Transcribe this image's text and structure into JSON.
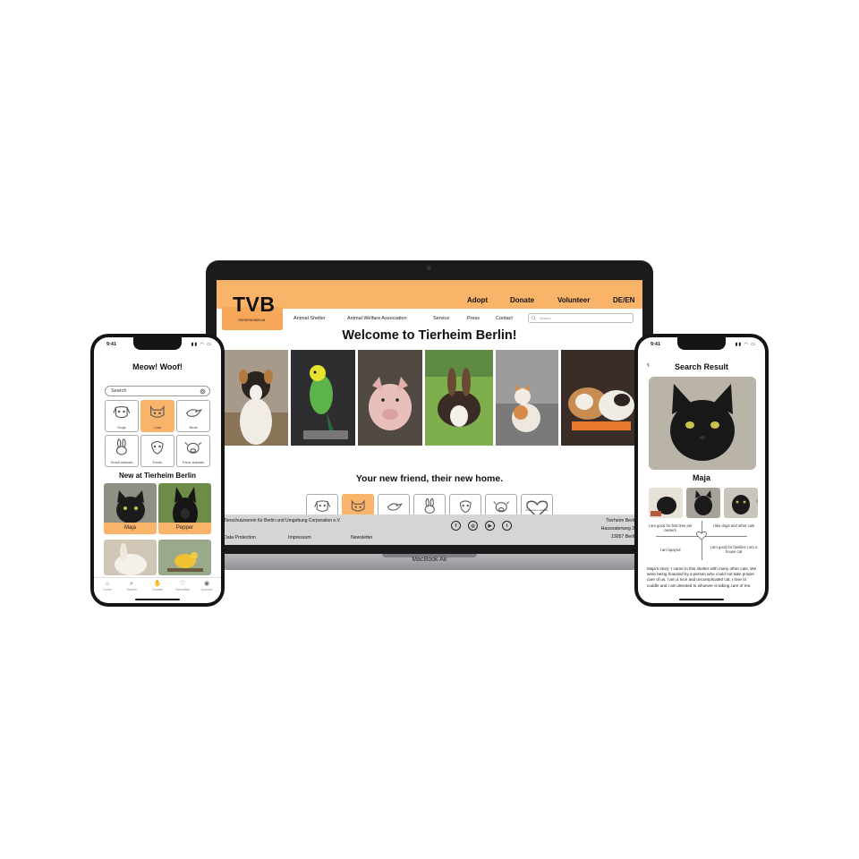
{
  "colors": {
    "accent": "#f9b469",
    "footer": "#d5d5d5",
    "device": "#151515"
  },
  "laptop": {
    "base_label": "MacBook Air",
    "web": {
      "logo": "TVB",
      "logo_tagline": "TIERHEIM BERLIN",
      "top_nav": [
        "Adopt",
        "Donate",
        "Volunteer",
        "DE/EN"
      ],
      "sub_nav": [
        "Animal Shelter",
        "Animal Welfare Association",
        "Service",
        "Press",
        "Contact"
      ],
      "search_placeholder": "Search",
      "title": "Welcome to Tierheim Berlin!",
      "photos": [
        "dog-photo",
        "budgie-photo",
        "pig-photo",
        "rabbit-photo",
        "cat-photo",
        "guinea-pig-photo"
      ],
      "subtitle": "Your new friend, their new home.",
      "categories": [
        {
          "label": "Dogs",
          "icon": "dog-icon"
        },
        {
          "label": "Cats",
          "icon": "cat-icon",
          "active": true
        },
        {
          "label": "Birds",
          "icon": "bird-icon"
        },
        {
          "label": "Small animals",
          "icon": "rabbit-icon"
        },
        {
          "label": "Exotic",
          "icon": "exotic-icon"
        },
        {
          "label": "Farm animals",
          "icon": "farm-animal-icon"
        },
        {
          "label": "Guarantee animals",
          "icon": "heart-icon"
        }
      ],
      "footer": {
        "org": "Tierschutzverein für Berlin und Umgebung Corporation e.V.",
        "links": [
          "Data Protection",
          "Impressum",
          "Newsletter"
        ],
        "social": [
          "facebook-icon",
          "instagram-icon",
          "youtube-icon",
          "twitter-icon"
        ],
        "address": [
          "Tierheim Berlin",
          "Hausvaterweg 39",
          "13057 Berlin"
        ]
      }
    }
  },
  "phone_left": {
    "time": "9:41",
    "title": "Meow! Woof!",
    "search_placeholder": "Search",
    "categories": [
      {
        "label": "Dogs",
        "icon": "dog-icon"
      },
      {
        "label": "Cats",
        "icon": "cat-icon",
        "active": true
      },
      {
        "label": "Birds",
        "icon": "bird-icon"
      },
      {
        "label": "Small animals",
        "icon": "rabbit-icon"
      },
      {
        "label": "Exotic",
        "icon": "exotic-icon"
      },
      {
        "label": "Farm animals",
        "icon": "farm-animal-icon"
      }
    ],
    "section_title": "New at Tierheim Berlin",
    "pets": [
      {
        "name": "Maja",
        "photo": "black-cat-photo"
      },
      {
        "name": "Pepper",
        "photo": "black-dog-photo"
      },
      {
        "name": "",
        "photo": "rabbit-photo"
      },
      {
        "name": "",
        "photo": "yellow-bird-photo"
      }
    ],
    "tabs": [
      {
        "label": "Home",
        "icon": "home-icon"
      },
      {
        "label": "Search",
        "icon": "search-icon"
      },
      {
        "label": "Donate",
        "icon": "donate-icon"
      },
      {
        "label": "Favourites",
        "icon": "heart-icon"
      },
      {
        "label": "Account",
        "icon": "account-icon"
      }
    ]
  },
  "phone_right": {
    "time": "9:41",
    "title": "Search Result",
    "pet_name": "Maja",
    "traits": [
      "I am good for first time pet owners",
      "I like dogs and other cats",
      "I am spayed",
      "I am good for families I am a house cat"
    ],
    "story": "Maja's story: I came to this shelter with many other cats. We were being hoarded by a person who could not take proper care of us. I am a nice and uncomplicated cat, I love to cuddle and I am devoted to whoever is taking care of me."
  }
}
